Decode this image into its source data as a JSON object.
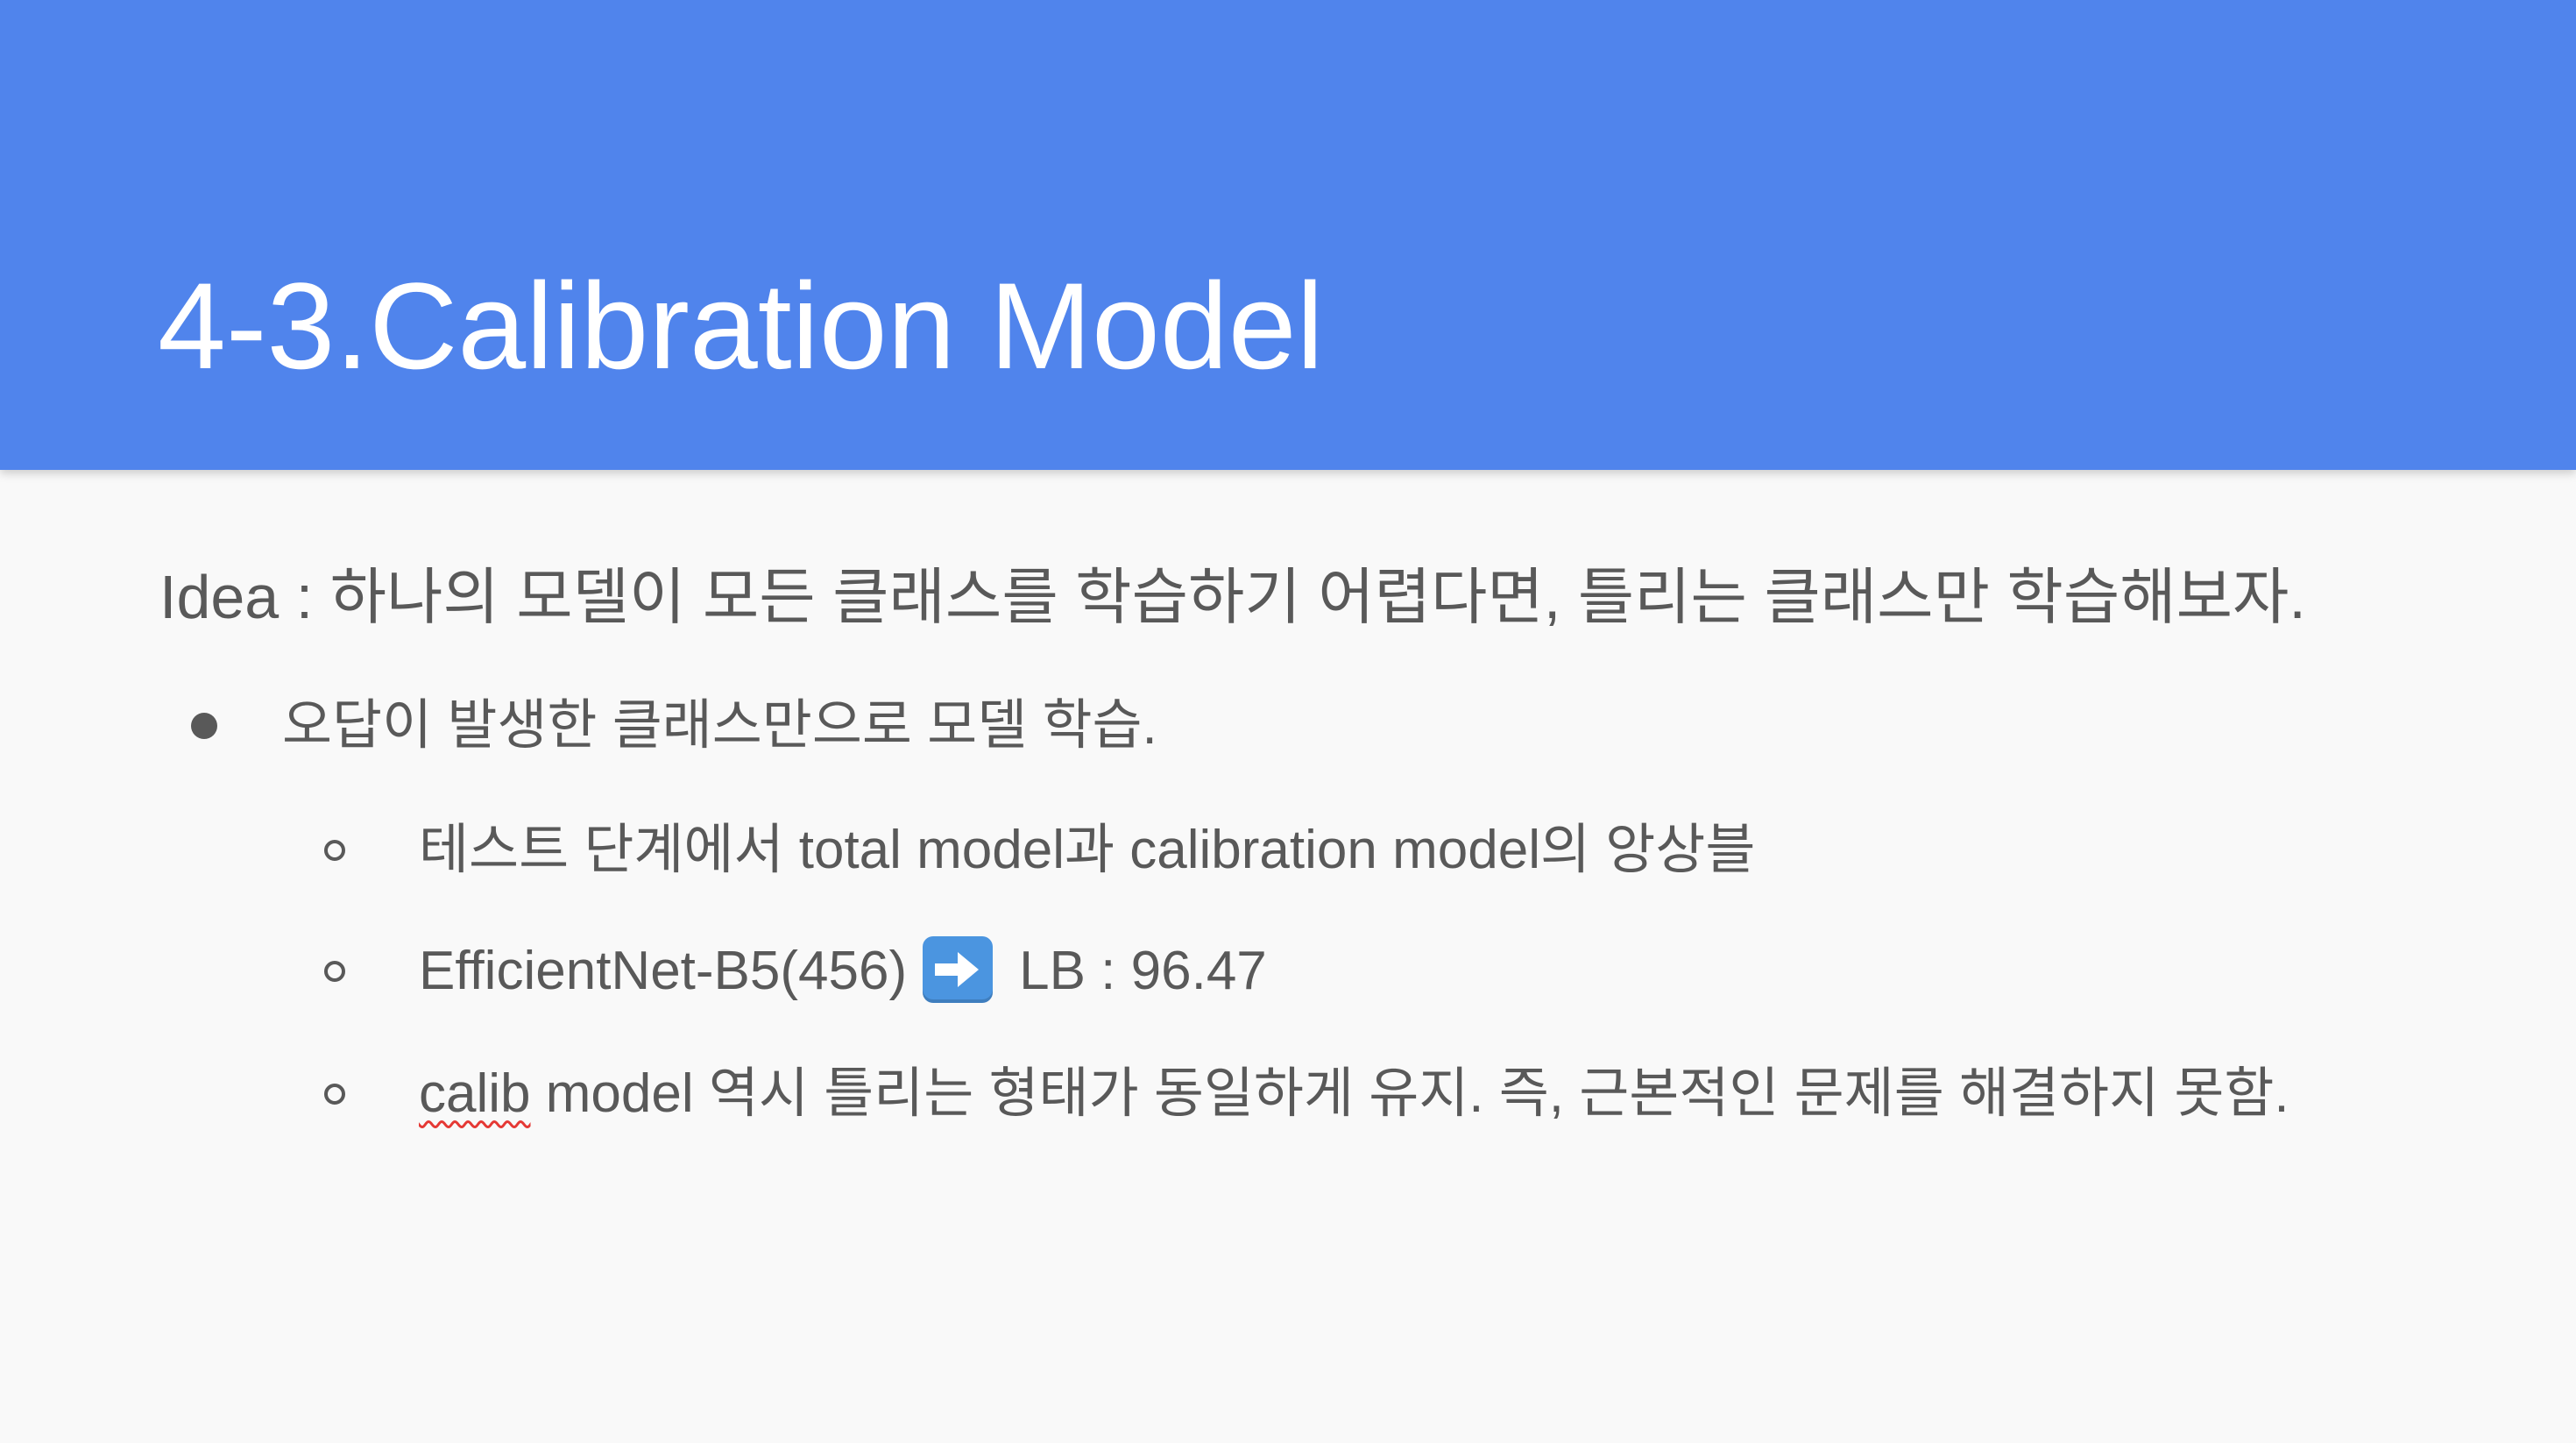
{
  "slide": {
    "title": "4-3.Calibration Model",
    "idea": "Idea : 하나의 모델이 모든 클래스를 학습하기 어렵다면, 틀리는 클래스만 학습해보자.",
    "bullet_1": "오답이 발생한 클래스만으로 모델 학습.",
    "sub_1": "테스트 단계에서 total model과 calibration model의 앙상블",
    "sub_2_left": "EfficientNet-B5(456)",
    "sub_2_right": "LB : 96.47",
    "sub_3_misspelled": "calib",
    "sub_3_rest": " model 역시 틀리는 형태가 동일하게 유지. 즉, 근본적인 문제를 해결하지 못함."
  },
  "colors": {
    "header_bg": "#5084ec",
    "body_bg": "#f9f9f9",
    "text": "#595959",
    "title_text": "#ffffff",
    "arrow_emoji_bg": "#4b95e0"
  },
  "icons": {
    "arrow": "right-arrow-emoji-icon"
  }
}
